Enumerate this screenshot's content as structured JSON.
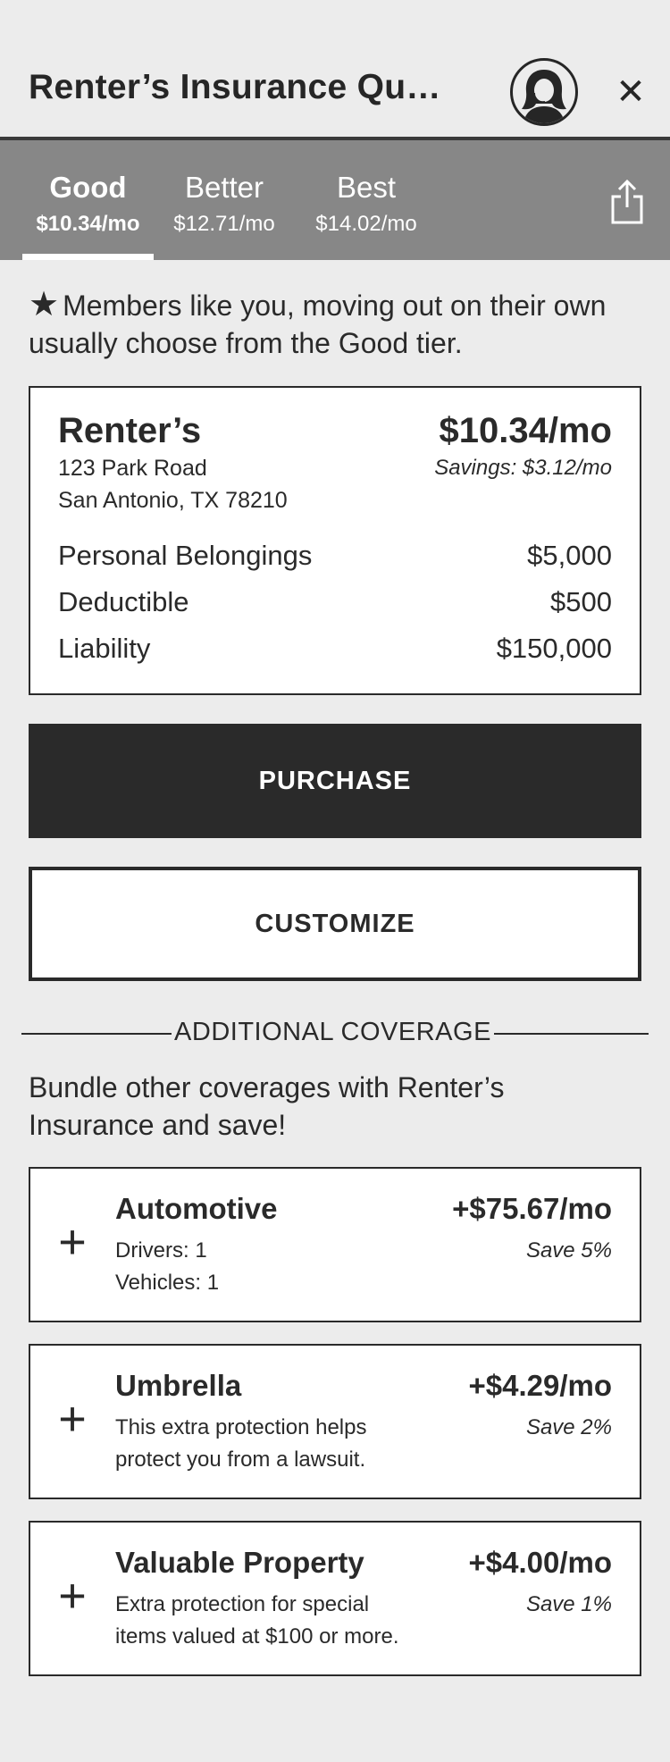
{
  "header": {
    "title": "Renter’s Insurance Qu…",
    "close_glyph": "✕",
    "avatar_icon": "agent-avatar-icon",
    "share_icon": "share-icon"
  },
  "tiers": [
    {
      "name": "Good",
      "price": "$10.34/mo",
      "active": true
    },
    {
      "name": "Better",
      "price": "$12.71/mo",
      "active": false
    },
    {
      "name": "Best",
      "price": "$14.02/mo",
      "active": false
    }
  ],
  "recommendation": {
    "star": "★",
    "text": "Members like you, moving out on their own usually choose from the Good tier."
  },
  "summary": {
    "policy_name": "Renter’s",
    "price": "$10.34/mo",
    "address_line1": "123 Park Road",
    "address_line2": "San Antonio, TX 78210",
    "savings": "Savings: $3.12/mo",
    "coverages": [
      {
        "label": "Personal Belongings",
        "value": "$5,000"
      },
      {
        "label": "Deductible",
        "value": "$500"
      },
      {
        "label": "Liability",
        "value": "$150,000"
      }
    ]
  },
  "actions": {
    "purchase": "PURCHASE",
    "customize": "CUSTOMIZE"
  },
  "additional": {
    "heading": "ADDITIONAL COVERAGE",
    "intro": "Bundle other coverages with Renter’s Insurance and save!",
    "plus_glyph": "+",
    "items": [
      {
        "name": "Automotive",
        "price": "+$75.67/mo",
        "line1": "Drivers: 1",
        "line2": "Vehicles: 1",
        "save": "Save 5%"
      },
      {
        "name": "Umbrella",
        "price": "+$4.29/mo",
        "line1": "This extra protection helps",
        "line2": "protect you from a lawsuit.",
        "save": "Save 2%"
      },
      {
        "name": "Valuable Property",
        "price": "+$4.00/mo",
        "line1": "Extra protection for special",
        "line2": "items valued at $100 or more.",
        "save": "Save 1%"
      }
    ]
  },
  "colors": {
    "background": "#ececec",
    "tab_bar": "#878787",
    "dark": "#2a2a2a",
    "card": "#ffffff"
  }
}
